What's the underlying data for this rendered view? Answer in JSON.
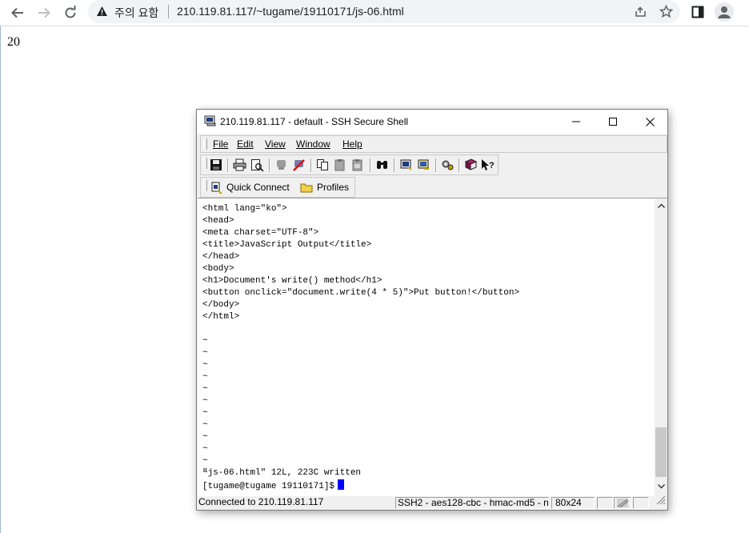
{
  "browser": {
    "security_label": "주의 요함",
    "url": "210.119.81.117/~tugame/19110171/js-06.html",
    "icons": [
      "back-icon",
      "forward-icon",
      "reload-icon",
      "warning-icon",
      "share-icon",
      "star-icon",
      "side-panel-icon",
      "profile-icon"
    ]
  },
  "page": {
    "output": "20"
  },
  "ssh": {
    "title": "210.119.81.117 - default - SSH Secure Shell",
    "menu": [
      {
        "label": "File"
      },
      {
        "label": "Edit"
      },
      {
        "label": "View"
      },
      {
        "label": "Window"
      },
      {
        "label": "Help"
      }
    ],
    "quick_connect_label": "Quick Connect",
    "profiles_label": "Profiles",
    "terminal_lines": [
      "<html lang=\"ko\">",
      "<head>",
      "<meta charset=\"UTF-8\">",
      "<title>JavaScript Output</title>",
      "</head>",
      "<body>",
      "<h1>Document's write() method</h1>",
      "<button onclick=\"document.write(4 * 5)\">Put button!</button>",
      "</body>",
      "</html>",
      "",
      "~",
      "~",
      "~",
      "~",
      "~",
      "~",
      "~",
      "~",
      "~",
      "~",
      "~",
      "~"
    ],
    "status_line": "\"js-06.html\" 12L, 223C written",
    "prompt": "[tugame@tugame 19110171]$",
    "status": {
      "connection": "Connected to 210.119.81.117",
      "cipher": "SSH2 - aes128-cbc - hmac-md5 - n",
      "size": "80x24"
    }
  },
  "colors": {
    "cursor": "#0000ff",
    "omnibox": "#f1f3f4"
  }
}
